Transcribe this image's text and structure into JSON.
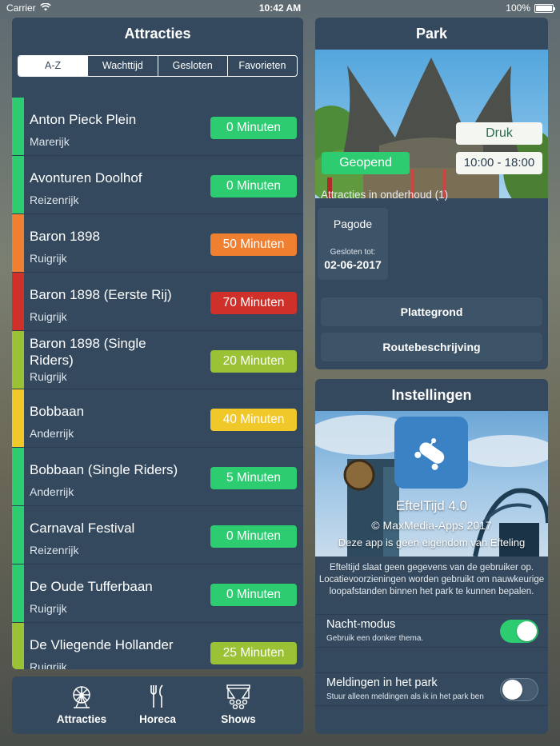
{
  "statusbar": {
    "carrier": "Carrier",
    "time": "10:42 AM",
    "battery": "100%"
  },
  "attractions": {
    "title": "Attracties",
    "segments": [
      "A-Z",
      "Wachttijd",
      "Gesloten",
      "Favorieten"
    ],
    "active_segment": "A-Z",
    "items": [
      {
        "name": "Anton Pieck Plein",
        "area": "Marerijk",
        "wait": "0 Minuten",
        "color": "#2ecc71"
      },
      {
        "name": "Avonturen Doolhof",
        "area": "Reizenrijk",
        "wait": "0 Minuten",
        "color": "#2ecc71"
      },
      {
        "name": "Baron 1898",
        "area": "Ruigrijk",
        "wait": "50 Minuten",
        "color": "#f08030"
      },
      {
        "name": "Baron 1898 (Eerste Rij)",
        "area": "Ruigrijk",
        "wait": "70 Minuten",
        "color": "#d0302a"
      },
      {
        "name": "Baron 1898 (Single Riders)",
        "area": "Ruigrijk",
        "wait": "20 Minuten",
        "color": "#9ac234"
      },
      {
        "name": "Bobbaan",
        "area": "Anderrijk",
        "wait": "40 Minuten",
        "color": "#f1c82a"
      },
      {
        "name": "Bobbaan (Single Riders)",
        "area": "Anderrijk",
        "wait": "5 Minuten",
        "color": "#2ecc71"
      },
      {
        "name": "Carnaval Festival",
        "area": "Reizenrijk",
        "wait": "0 Minuten",
        "color": "#2ecc71"
      },
      {
        "name": "De Oude Tufferbaan",
        "area": "Ruigrijk",
        "wait": "0 Minuten",
        "color": "#2ecc71"
      },
      {
        "name": "De Vliegende Hollander",
        "area": "Ruigrijk",
        "wait": "25 Minuten",
        "color": "#9ac234"
      }
    ]
  },
  "tabbar": {
    "tabs": [
      {
        "label": "Attracties",
        "icon": "ferris-wheel-icon"
      },
      {
        "label": "Horeca",
        "icon": "fork-knife-icon"
      },
      {
        "label": "Shows",
        "icon": "theater-icon"
      }
    ]
  },
  "park": {
    "title": "Park",
    "status": "Geopend",
    "crowd": "Druk",
    "hours": "10:00 - 18:00",
    "maintenance_label": "Attracties in onderhoud (1)",
    "maintenance": [
      {
        "name": "Pagode",
        "closed_label": "Gesloten tot:",
        "date": "02-06-2017"
      }
    ],
    "buttons": {
      "map": "Plattegrond",
      "route": "Routebeschrijving"
    }
  },
  "settings": {
    "title": "Instellingen",
    "app_version": "EftelTijd 4.0",
    "copyright": "© MaxMedia-Apps 2017",
    "disclaimer": "Deze app is geen eigendom van Efteling",
    "privacy_line1": "Efteltijd slaat geen gegevens van de gebruiker op.",
    "privacy_line2": "Locatievoorzieningen worden gebruikt om nauwkeurige",
    "privacy_line3": "loopafstanden binnen het park te kunnen bepalen.",
    "night_mode": {
      "title": "Nacht-modus",
      "subtitle": "Gebruik een donker thema.",
      "enabled": true
    },
    "notifications": {
      "title": "Meldingen in het park",
      "subtitle": "Stuur alleen meldingen als ik in het park ben",
      "enabled": false
    }
  }
}
